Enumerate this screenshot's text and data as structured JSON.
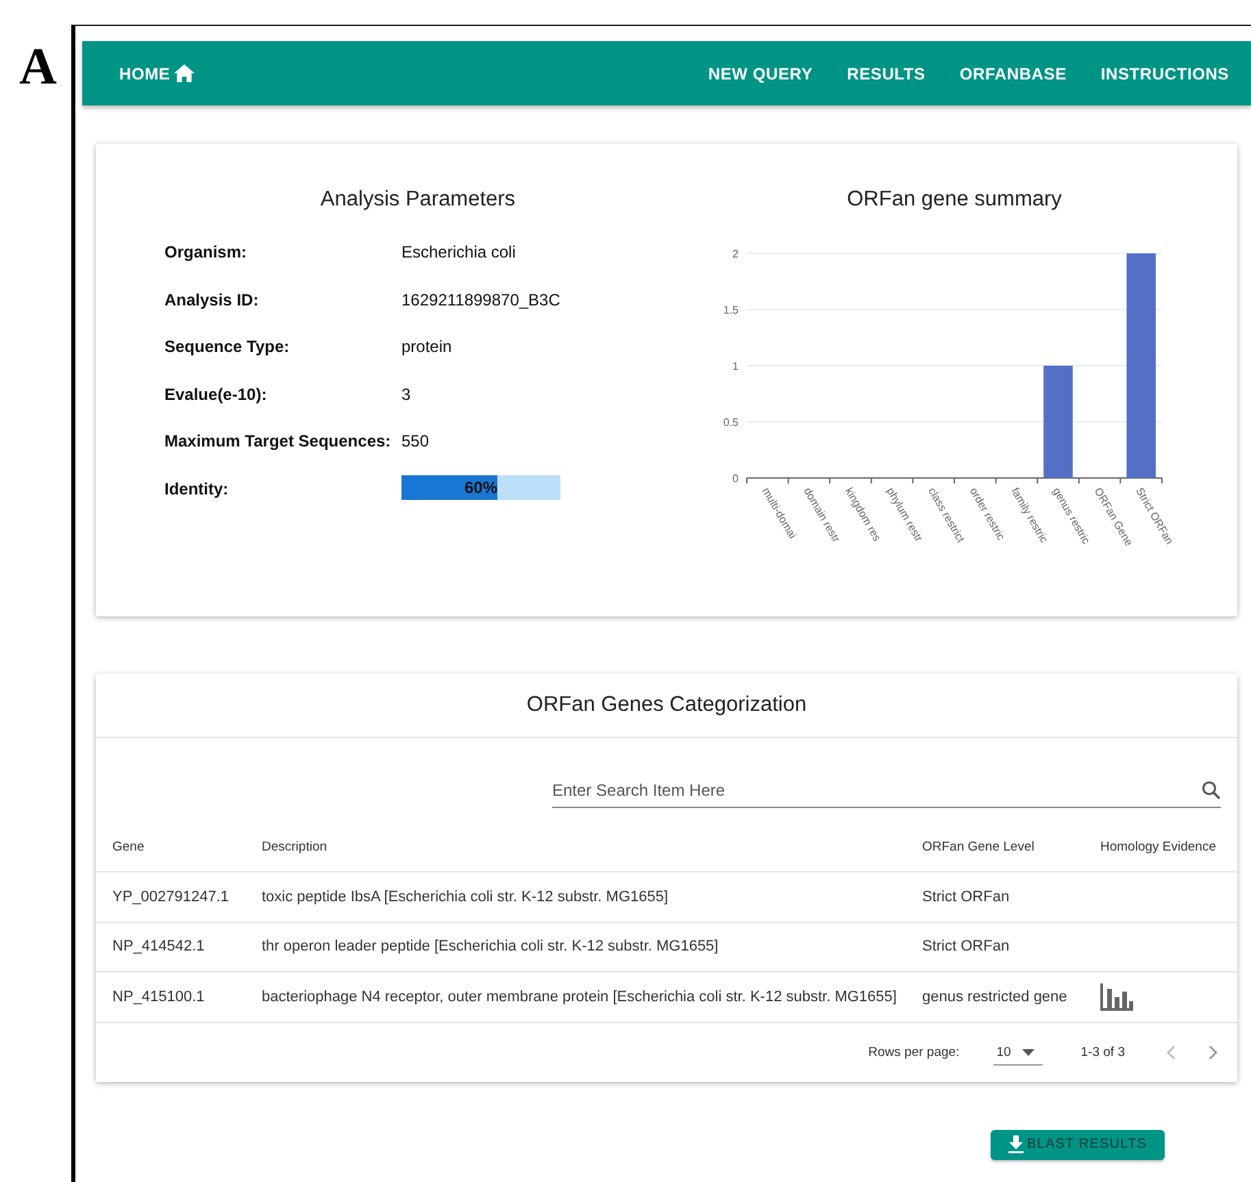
{
  "figure_label": "A",
  "nav": {
    "home": "HOME",
    "links": [
      "NEW QUERY",
      "RESULTS",
      "ORFANBASE",
      "INSTRUCTIONS"
    ]
  },
  "parameters": {
    "title": "Analysis Parameters",
    "rows": [
      {
        "label": "Organism:",
        "value": "Escherichia coli"
      },
      {
        "label": "Analysis ID:",
        "value": "1629211899870_B3C"
      },
      {
        "label": "Sequence Type:",
        "value": "protein"
      },
      {
        "label": "Evalue(e-10):",
        "value": "3"
      },
      {
        "label": "Maximum Target Sequences:",
        "value": "550"
      }
    ],
    "identity": {
      "label": "Identity:",
      "level": 0.6,
      "reading": "60%"
    }
  },
  "summary": {
    "title": "ORFan gene summary",
    "chart_data": {
      "type": "bar",
      "categories": [
        "multi-domai",
        "domain restr",
        "kingdom res",
        "phylum restr",
        "class restrict",
        "order restric",
        "family restric",
        "genus restric",
        "ORFan Gene",
        "Strict ORFan"
      ],
      "series": [
        {
          "color": "#5470c6",
          "values": [
            0,
            0,
            0,
            0,
            0,
            0,
            0,
            1,
            0,
            2
          ]
        }
      ],
      "ylim": [
        0,
        2
      ],
      "grid": true,
      "yticks": [
        0,
        0.5,
        1,
        1.5,
        2
      ]
    }
  },
  "categorization": {
    "title": "ORFan Genes Categorization",
    "search": {
      "placeholder": "Enter Search Item Here"
    },
    "columns": [
      "Gene",
      "Description",
      "ORFan Gene Level",
      "Homology Evidence"
    ],
    "rows": [
      {
        "gene": "YP_002791247.1",
        "description": "toxic peptide IbsA [Escherichia coli str. K-12 substr. MG1655]",
        "level": "Strict ORFan",
        "evidence": false
      },
      {
        "gene": "NP_414542.1",
        "description": "thr operon leader peptide [Escherichia coli str. K-12 substr. MG1655]",
        "level": "Strict ORFan",
        "evidence": false
      },
      {
        "gene": "NP_415100.1",
        "description": "bacteriophage N4 receptor, outer membrane protein [Escherichia coli str. K-12 substr. MG1655]",
        "level": "genus restricted gene",
        "evidence": true
      }
    ],
    "footer": {
      "rows_per_page_label": "Rows per page:",
      "rows_per_page": "10",
      "range": "1-3 of 3"
    }
  },
  "download_button": "BLAST RESULTS"
}
